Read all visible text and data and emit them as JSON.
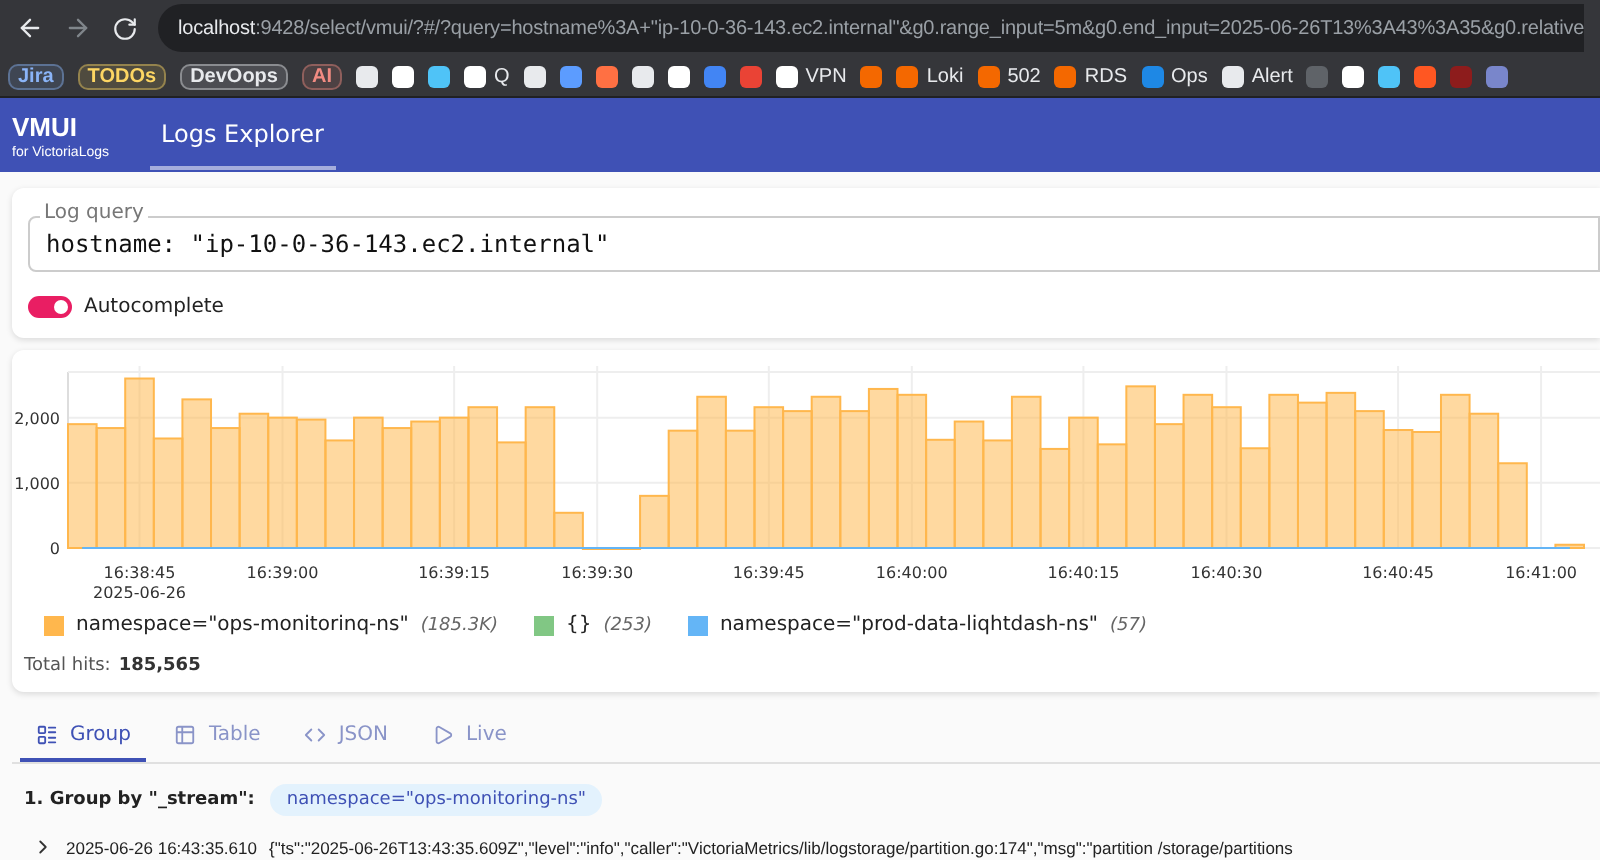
{
  "browser": {
    "url_host": "localhost",
    "url_rest": ":9428/select/vmui/?#/?query=hostname%3A+\"ip-10-0-36-143.ec2.internal\"&g0.range_input=5m&g0.end_input=2025-06-26T13%3A43%3A35&g0.relative",
    "bookmarks": [
      {
        "kind": "tag",
        "label": "Jira",
        "color": "#8ab4f8"
      },
      {
        "kind": "tag",
        "label": "TODOs",
        "color": "#fdd663"
      },
      {
        "kind": "tag",
        "label": "DevOops",
        "color": "#e8eaed"
      },
      {
        "kind": "tag",
        "label": "AI",
        "color": "#f28b82"
      },
      {
        "kind": "icon",
        "color": "#e8eaed"
      },
      {
        "kind": "icon",
        "color": "#ffffff"
      },
      {
        "kind": "icon",
        "color": "#4fc3f7"
      },
      {
        "kind": "link",
        "label": "Q",
        "color": "#ffffff"
      },
      {
        "kind": "icon",
        "color": "#e8eaed"
      },
      {
        "kind": "icon",
        "color": "#5c9cff"
      },
      {
        "kind": "icon",
        "color": "#ff7043"
      },
      {
        "kind": "icon",
        "color": "#e8eaed"
      },
      {
        "kind": "icon",
        "color": "#ffffff"
      },
      {
        "kind": "icon",
        "color": "#4285f4"
      },
      {
        "kind": "icon",
        "color": "#ea4335"
      },
      {
        "kind": "link",
        "label": "VPN",
        "color": "#ffffff"
      },
      {
        "kind": "icon",
        "color": "#f46800"
      },
      {
        "kind": "link",
        "label": "Loki",
        "color": "#f46800"
      },
      {
        "kind": "link",
        "label": "502",
        "color": "#f46800"
      },
      {
        "kind": "link",
        "label": "RDS",
        "color": "#f46800"
      },
      {
        "kind": "link",
        "label": "Ops",
        "color": "#1e88e5"
      },
      {
        "kind": "link",
        "label": "Alert",
        "color": "#e8eaed"
      },
      {
        "kind": "icon",
        "color": "#5f6368"
      },
      {
        "kind": "icon",
        "color": "#ffffff"
      },
      {
        "kind": "icon",
        "color": "#4fc3f7"
      },
      {
        "kind": "icon",
        "color": "#ff5722"
      },
      {
        "kind": "icon",
        "color": "#8d1c1c"
      },
      {
        "kind": "icon",
        "color": "#7986cb"
      }
    ]
  },
  "app": {
    "logo": "VMUI",
    "logo_sub": "for VictoriaLogs",
    "nav": [
      {
        "label": "Logs Explorer",
        "selected": true
      }
    ]
  },
  "query": {
    "label": "Log query",
    "value": "hostname: \"ip-10-0-36-143.ec2.internal\"",
    "autocomplete": {
      "label": "Autocomplete",
      "on": true
    }
  },
  "hits": {
    "chart_data": {
      "type": "bar",
      "categories": [
        null,
        null,
        "16:38:45",
        null,
        null,
        null,
        null,
        "16:39:00",
        null,
        null,
        null,
        null,
        null,
        "16:39:15",
        null,
        null,
        null,
        null,
        "16:39:30",
        null,
        null,
        null,
        null,
        null,
        "16:39:45",
        null,
        null,
        null,
        null,
        "16:40:00",
        null,
        null,
        null,
        null,
        null,
        "16:40:15",
        null,
        null,
        null,
        null,
        "16:40:30",
        null,
        null,
        null,
        null,
        null,
        "16:40:45",
        null,
        null,
        null,
        null,
        "16:41:00",
        null
      ],
      "grid": true,
      "ylim": [
        0,
        2700
      ],
      "yticks": [
        {
          "value": 0,
          "label": "0"
        },
        {
          "value": 1000,
          "label": "1,000"
        },
        {
          "value": 2000,
          "label": "2,000"
        }
      ],
      "series": [
        {
          "name": "namespace=\"ops-monitorinq-ns\"",
          "color": "#ffb74d",
          "values": [
            1900,
            1840,
            2600,
            1680,
            2280,
            1840,
            2060,
            2000,
            1970,
            1650,
            2000,
            1840,
            1940,
            2000,
            2160,
            1620,
            2160,
            540,
            0,
            0,
            800,
            1800,
            2320,
            1800,
            2160,
            2100,
            2320,
            2100,
            2440,
            2350,
            1660,
            1940,
            1650,
            2320,
            1520,
            2000,
            1590,
            2480,
            1900,
            2350,
            2160,
            1530,
            2350,
            2230,
            2380,
            2100,
            1810,
            1780,
            2350,
            2060,
            1300,
            null,
            50
          ]
        },
        {
          "name": "{}",
          "color": "#81c784",
          "values": [
            0,
            0,
            0,
            0,
            0,
            0,
            0,
            0,
            0,
            0,
            0,
            0,
            0,
            0,
            0,
            0,
            0,
            0,
            0,
            0,
            0,
            0,
            0,
            0,
            0,
            0,
            0,
            0,
            0,
            0,
            0,
            0,
            0,
            0,
            0,
            0,
            0,
            0,
            0,
            0,
            0,
            0,
            0,
            0,
            0,
            0,
            0,
            0,
            0,
            0,
            0,
            0,
            0
          ]
        },
        {
          "name": "namespace=\"prod-data-liqhtdash-ns\"",
          "color": "#64b5f6",
          "values": [
            0,
            0,
            0,
            0,
            0,
            0,
            0,
            0,
            0,
            0,
            0,
            0,
            0,
            0,
            0,
            0,
            0,
            0,
            0,
            0,
            0,
            0,
            0,
            0,
            0,
            0,
            0,
            0,
            0,
            0,
            0,
            0,
            0,
            0,
            0,
            0,
            0,
            0,
            0,
            0,
            0,
            0,
            0,
            0,
            0,
            0,
            0,
            0,
            0,
            0,
            0,
            0,
            0
          ]
        }
      ]
    },
    "date_label": "2025-06-26",
    "legend": [
      {
        "count": "(185.3K)"
      },
      {
        "count": "(253)"
      },
      {
        "count": "(57)"
      }
    ],
    "total_label": "Total hits:",
    "total_value": "185,565"
  },
  "view_tabs": [
    {
      "kind": "group",
      "label": "Group",
      "selected": true
    },
    {
      "kind": "table",
      "label": "Table",
      "selected": false
    },
    {
      "kind": "json",
      "label": "JSON",
      "selected": false
    },
    {
      "kind": "live",
      "label": "Live",
      "selected": false
    }
  ],
  "group": {
    "title": "1. Group by \"_stream\":",
    "tag": "namespace=\"ops-monitoring-ns\"",
    "rows": [
      {
        "time": "2025-06-26 16:43:35.610",
        "message": "{\"ts\":\"2025-06-26T13:43:35.609Z\",\"level\":\"info\",\"caller\":\"VictoriaMetrics/lib/logstorage/partition.go:174\",\"msg\":\"partition /storage/partitions",
        "expanded": false
      }
    ]
  }
}
